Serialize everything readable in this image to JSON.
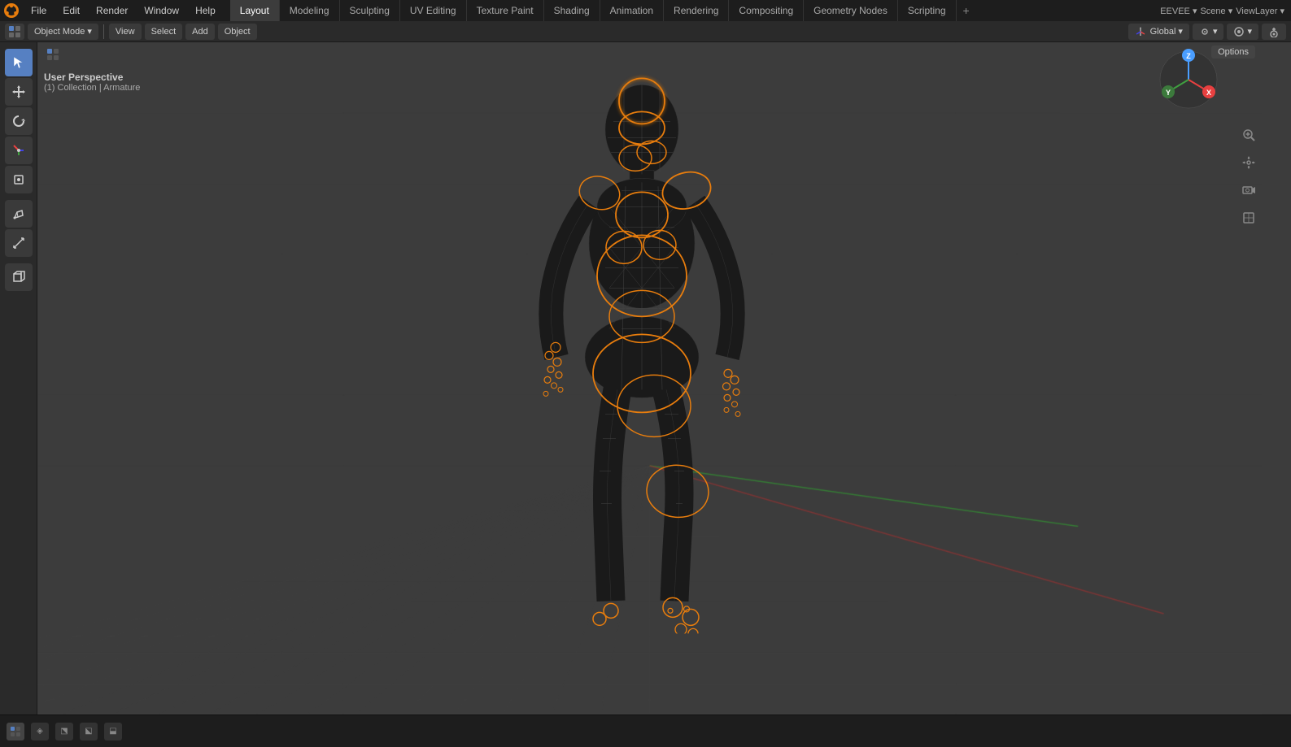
{
  "app": {
    "logo": "🔷",
    "title": "Blender"
  },
  "top_menu": {
    "items": [
      {
        "label": "File",
        "id": "file"
      },
      {
        "label": "Edit",
        "id": "edit"
      },
      {
        "label": "Render",
        "id": "render"
      },
      {
        "label": "Window",
        "id": "window"
      },
      {
        "label": "Help",
        "id": "help"
      }
    ]
  },
  "workspace_tabs": [
    {
      "label": "Layout",
      "id": "layout",
      "active": true
    },
    {
      "label": "Modeling",
      "id": "modeling",
      "active": false
    },
    {
      "label": "Sculpting",
      "id": "sculpting",
      "active": false
    },
    {
      "label": "UV Editing",
      "id": "uv-editing",
      "active": false
    },
    {
      "label": "Texture Paint",
      "id": "texture-paint",
      "active": false
    },
    {
      "label": "Shading",
      "id": "shading",
      "active": false
    },
    {
      "label": "Animation",
      "id": "animation",
      "active": false
    },
    {
      "label": "Rendering",
      "id": "rendering",
      "active": false
    },
    {
      "label": "Compositing",
      "id": "compositing",
      "active": false
    },
    {
      "label": "Geometry Nodes",
      "id": "geometry-nodes",
      "active": false
    },
    {
      "label": "Scripting",
      "id": "scripting",
      "active": false
    }
  ],
  "toolbar": {
    "mode_label": "Object Mode",
    "view_label": "View",
    "select_label": "Select",
    "add_label": "Add",
    "object_label": "Object",
    "transform_label": "Global",
    "options_label": "Options"
  },
  "viewport": {
    "perspective_label": "User Perspective",
    "collection_label": "(1) Collection | Armature"
  },
  "left_tools": [
    {
      "icon": "cursor",
      "label": "Cursor",
      "unicode": "⊕",
      "active": true
    },
    {
      "icon": "move",
      "label": "Move",
      "unicode": "✛"
    },
    {
      "icon": "rotate",
      "label": "Rotate",
      "unicode": "↻"
    },
    {
      "icon": "scale",
      "label": "Scale",
      "unicode": "⤡"
    },
    {
      "icon": "transform",
      "label": "Transform",
      "unicode": "⊞"
    },
    {
      "icon": "annotate",
      "label": "Annotate",
      "unicode": "✏"
    },
    {
      "icon": "measure",
      "label": "Measure",
      "unicode": "📐"
    },
    {
      "icon": "add-cube",
      "label": "Add Cube",
      "unicode": "◱"
    }
  ],
  "right_tools": [
    {
      "icon": "zoom",
      "label": "Zoom",
      "unicode": "🔍"
    },
    {
      "icon": "pan",
      "label": "Pan",
      "unicode": "✋"
    },
    {
      "icon": "camera-view",
      "label": "Camera",
      "unicode": "🎥"
    },
    {
      "icon": "ortho",
      "label": "Orthographic",
      "unicode": "⊡"
    }
  ],
  "status_bar": {
    "icons": [
      "⬡",
      "◈",
      "⬔",
      "⬕",
      "⬓"
    ]
  },
  "nav_widget": {
    "x_label": "X",
    "y_label": "Y",
    "z_label": "Z"
  }
}
